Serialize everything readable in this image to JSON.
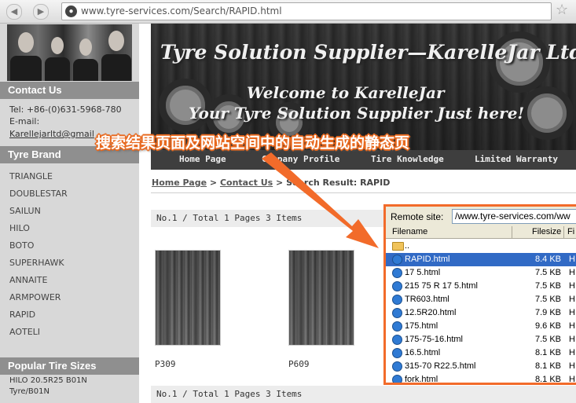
{
  "browser": {
    "url": "www.tyre-services.com/Search/RAPID.html",
    "back_icon": "back-arrow-icon",
    "forward_icon": "forward-arrow-icon",
    "bookmark_icon": "star-icon"
  },
  "sidebar": {
    "contact_heading": "Contact Us",
    "tel": "Tel: +86-(0)631-5968-780",
    "email_label": "E-mail:",
    "email": "Karellejarltd@gmail",
    "brand_heading": "Tyre Brand",
    "brands": [
      "TRIANGLE",
      "DOUBLESTAR",
      "SAILUN",
      "HILO",
      "BOTO",
      "SUPERHAWK",
      "ANNAITE",
      "ARMPOWER",
      "RAPID",
      "AOTELI"
    ],
    "sizes_heading": "Popular Tire Sizes",
    "sizes": [
      "HILO 20.5R25 B01N",
      "Tyre/B01N"
    ]
  },
  "banner": {
    "title": "Tyre Solution Supplier—KarelleJar Ltd",
    "welcome_line1": "Welcome to KarelleJar",
    "welcome_line2": "Your Tyre Solution Supplier Just here!"
  },
  "nav": {
    "items": [
      "Home Page",
      "Company Profile",
      "Tire Knowledge",
      "Limited Warranty"
    ]
  },
  "breadcrumb": {
    "home": "Home Page",
    "sep1": ">",
    "contact": "Contact Us",
    "sep2": ">",
    "current": "Search Result: RAPID"
  },
  "results": {
    "pager_top": "No.1 / Total 1 Pages 3 Items",
    "pager_bottom": "No.1 / Total 1 Pages 3 Items",
    "products": [
      {
        "name": "P309"
      },
      {
        "name": "P609"
      }
    ]
  },
  "annotation": {
    "text": "搜索结果页面及网站空间中的自动生成的静态页",
    "color": "#f26b2a"
  },
  "ftp": {
    "remote_label": "Remote site:",
    "remote_path": "/www.tyre-services.com/ww",
    "columns": {
      "filename": "Filename",
      "filesize": "Filesize",
      "filetype": "Fi"
    },
    "files": [
      {
        "name": "..",
        "size": "",
        "type": "",
        "icon": "folder-icon",
        "selected": false
      },
      {
        "name": "RAPID.html",
        "size": "8.4 KB",
        "type": "H",
        "icon": "html-file-icon",
        "selected": true
      },
      {
        "name": "17 5.html",
        "size": "7.5 KB",
        "type": "H",
        "icon": "html-file-icon",
        "selected": false
      },
      {
        "name": "215 75 R 17 5.html",
        "size": "7.5 KB",
        "type": "H",
        "icon": "html-file-icon",
        "selected": false
      },
      {
        "name": "TR603.html",
        "size": "7.5 KB",
        "type": "H",
        "icon": "html-file-icon",
        "selected": false
      },
      {
        "name": "12.5R20.html",
        "size": "7.9 KB",
        "type": "H",
        "icon": "html-file-icon",
        "selected": false
      },
      {
        "name": "175.html",
        "size": "9.6 KB",
        "type": "H",
        "icon": "html-file-icon",
        "selected": false
      },
      {
        "name": "175-75-16.html",
        "size": "7.5 KB",
        "type": "H",
        "icon": "html-file-icon",
        "selected": false
      },
      {
        "name": "16.5.html",
        "size": "8.1 KB",
        "type": "H",
        "icon": "html-file-icon",
        "selected": false
      },
      {
        "name": "315-70 R22.5.html",
        "size": "8.1 KB",
        "type": "H",
        "icon": "html-file-icon",
        "selected": false
      },
      {
        "name": "fork.html",
        "size": "8.1 KB",
        "type": "H",
        "icon": "html-file-icon",
        "selected": false
      }
    ]
  }
}
